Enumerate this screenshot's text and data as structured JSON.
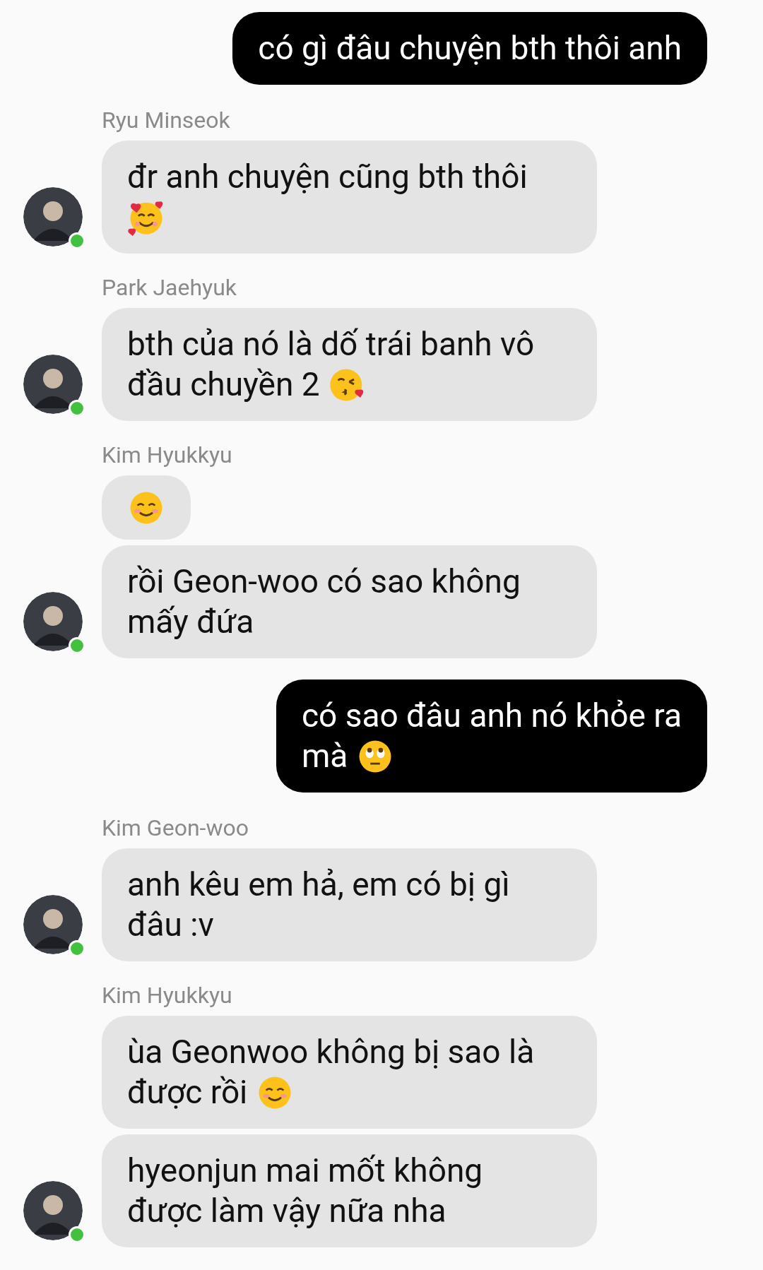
{
  "messages": [
    {
      "kind": "sent",
      "messages": [
        {
          "lines": [
            "có gì đâu chuyện bth thôi anh"
          ]
        }
      ]
    },
    {
      "kind": "received",
      "sender": "Ryu Minseok",
      "online": true,
      "messages": [
        {
          "lines": [
            "đr anh chuyện cũng bth thôi"
          ],
          "icon": {
            "kind": "hearts",
            "own_line": true
          }
        }
      ]
    },
    {
      "kind": "received",
      "sender": "Park Jaehyuk",
      "online": true,
      "messages": [
        {
          "lines": [
            "bth của nó là dố trái banh vô",
            "đầu chuyền 2"
          ],
          "icon": {
            "kind": "kiss",
            "own_line": false
          }
        }
      ]
    },
    {
      "kind": "received",
      "sender": "Kim Hyukkyu",
      "online": true,
      "messages": [
        {
          "icon": {
            "kind": "blush"
          }
        },
        {
          "lines": [
            "rồi Geon-woo có sao không",
            "mấy đứa"
          ]
        }
      ]
    },
    {
      "kind": "sent",
      "messages": [
        {
          "lines": [
            "có sao đâu anh nó khỏe ra",
            "mà"
          ],
          "icon": {
            "kind": "eyeroll",
            "own_line": false
          }
        }
      ]
    },
    {
      "kind": "received",
      "sender": "Kim Geon-woo",
      "online": true,
      "messages": [
        {
          "lines": [
            "anh kêu em hả, em có bị gì",
            "đâu :v"
          ]
        }
      ]
    },
    {
      "kind": "received",
      "sender": "Kim Hyukkyu",
      "online": true,
      "messages": [
        {
          "lines": [
            "ùa Geonwoo không bị sao là",
            "được rồi"
          ],
          "icon": {
            "kind": "blush",
            "own_line": false
          }
        },
        {
          "lines": [
            "hyeonjun mai mốt không",
            "được làm vậy nữa nha"
          ]
        }
      ]
    }
  ]
}
